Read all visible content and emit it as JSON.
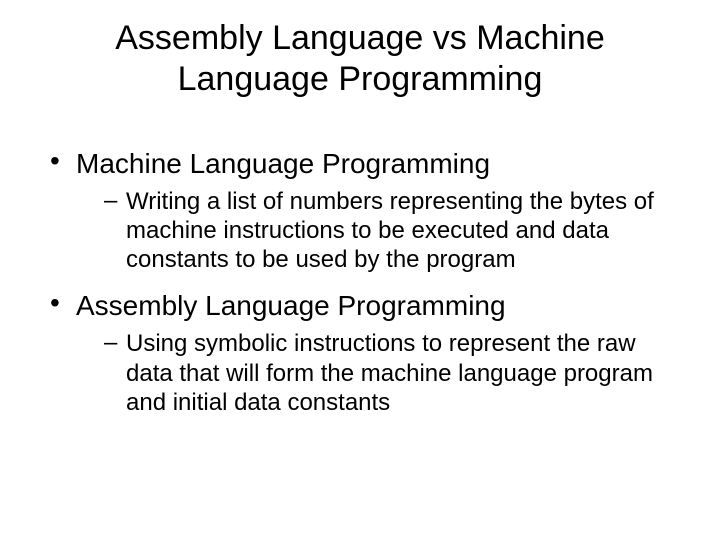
{
  "title": "Assembly Language vs Machine Language Programming",
  "bullets": [
    {
      "heading": "Machine Language Programming",
      "sub": "Writing a list of numbers representing the bytes of machine instructions to be executed and data constants to be used by the program"
    },
    {
      "heading": "Assembly Language Programming",
      "sub": "Using symbolic instructions to represent the raw data that will form the machine language program and initial data constants"
    }
  ]
}
